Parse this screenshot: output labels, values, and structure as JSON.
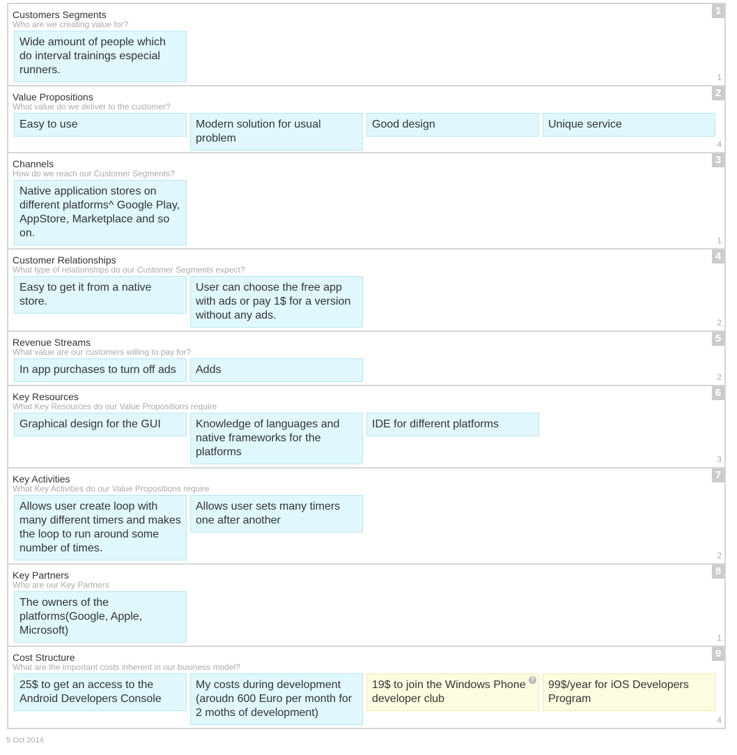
{
  "blocks": [
    {
      "title": "Customers Segments",
      "subtitle": "Who are we creating value for?",
      "number": "1",
      "count": "1",
      "stickies": [
        {
          "text": "Wide amount of people which do interval trainings especial runners.",
          "color": "blue"
        }
      ]
    },
    {
      "title": "Value Propositions",
      "subtitle": "What value do we deliver to the customer?",
      "number": "2",
      "count": "4",
      "stickies": [
        {
          "text": "Easy to use",
          "color": "blue"
        },
        {
          "text": "Modern solution for usual problem",
          "color": "blue"
        },
        {
          "text": "Good design",
          "color": "blue"
        },
        {
          "text": "Unique service",
          "color": "blue"
        }
      ]
    },
    {
      "title": "Channels",
      "subtitle": "How do we reach our Customer Segments?",
      "number": "3",
      "count": "1",
      "stickies": [
        {
          "text": "Native application stores on different platforms^ Google Play, AppStore, Marketplace and so on.",
          "color": "blue"
        }
      ]
    },
    {
      "title": "Customer Relationships",
      "subtitle": "What type of relationships do our Customer Segments expect?",
      "number": "4",
      "count": "2",
      "stickies": [
        {
          "text": "Easy to get it from a native store.",
          "color": "blue"
        },
        {
          "text": "User can choose the free app with ads or pay 1$ for a version without any ads.",
          "color": "blue"
        }
      ]
    },
    {
      "title": "Revenue Streams",
      "subtitle": "What value are our customers willing to pay for?",
      "number": "5",
      "count": "2",
      "stickies": [
        {
          "text": "In app purchases to turn off ads",
          "color": "blue"
        },
        {
          "text": "Adds",
          "color": "blue"
        }
      ]
    },
    {
      "title": "Key Resources",
      "subtitle": "What Key Resources do our Value Propositions require",
      "number": "6",
      "count": "3",
      "stickies": [
        {
          "text": "Graphical design for the GUI",
          "color": "blue"
        },
        {
          "text": "Knowledge of languages and native frameworks for the platforms",
          "color": "blue"
        },
        {
          "text": "IDE for different platforms",
          "color": "blue"
        }
      ]
    },
    {
      "title": "Key Activities",
      "subtitle": "What Key Activities do our Value Propositions require",
      "number": "7",
      "count": "2",
      "stickies": [
        {
          "text": "Allows user create loop with many different timers and makes the loop to run around some number of times.",
          "color": "blue"
        },
        {
          "text": "Allows user sets many timers one after another",
          "color": "blue"
        }
      ]
    },
    {
      "title": "Key Partners",
      "subtitle": "Who are our Key Partners",
      "number": "8",
      "count": "1",
      "stickies": [
        {
          "text": "The owners of the platforms(Google, Apple, Microsoft)",
          "color": "blue"
        }
      ]
    },
    {
      "title": "Cost Structure",
      "subtitle": "What are the important costs inherent in our business model?",
      "number": "9",
      "count": "4",
      "stickies": [
        {
          "text": "25$ to get an access to the Android Developers Console",
          "color": "blue"
        },
        {
          "text": "My costs during development (aroudn 600 Euro per month for 2 moths of development)",
          "color": "blue"
        },
        {
          "text": "19$ to join the Windows Phone developer club",
          "color": "yellow",
          "help_icon": "help-icon"
        },
        {
          "text": "99$/year for iOS Developers Program",
          "color": "yellow"
        }
      ]
    }
  ],
  "footer": {
    "date": "5 Oct 2014"
  },
  "colors": {
    "sticky_blue": "#dff7fd",
    "sticky_yellow": "#fdfce0",
    "number_badge": "#cccccc",
    "border": "#d6d6d6"
  }
}
